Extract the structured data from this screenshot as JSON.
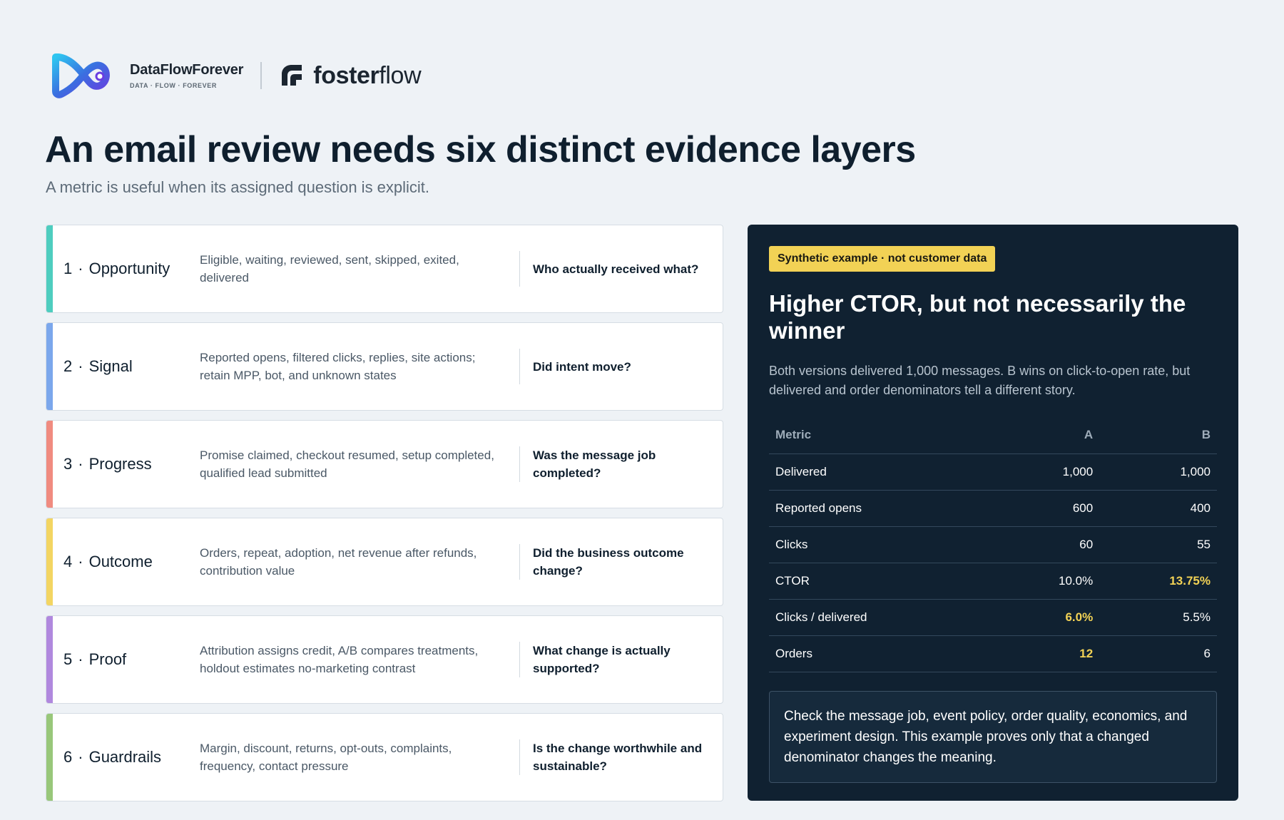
{
  "brand": {
    "dff_name": "DataFlowForever",
    "dff_tagline": "DATA · FLOW · FOREVER",
    "ff_bold": "foster",
    "ff_light": "flow"
  },
  "heading": {
    "title": "An email review needs six distinct evidence layers",
    "subtitle": "A metric is useful when its assigned question is explicit."
  },
  "layers": [
    {
      "num": "1",
      "name": "Opportunity",
      "desc": "Eligible, waiting, reviewed, sent, skipped, exited, delivered",
      "question": "Who actually received what?",
      "color": "#4ecdbf"
    },
    {
      "num": "2",
      "name": "Signal",
      "desc": "Reported opens, filtered clicks, replies, site actions; retain MPP, bot, and unknown states",
      "question": "Did intent move?",
      "color": "#7ba7ec"
    },
    {
      "num": "3",
      "name": "Progress",
      "desc": "Promise claimed, checkout resumed, setup completed, qualified lead submitted",
      "question": "Was the message job completed?",
      "color": "#f08b80"
    },
    {
      "num": "4",
      "name": "Outcome",
      "desc": "Orders, repeat, adoption, net revenue after refunds, contribution value",
      "question": "Did the business outcome change?",
      "color": "#f3d562"
    },
    {
      "num": "5",
      "name": "Proof",
      "desc": "Attribution assigns credit, A/B compares treatments, holdout estimates no-marketing contrast",
      "question": "What change is actually supported?",
      "color": "#b088de"
    },
    {
      "num": "6",
      "name": "Guardrails",
      "desc": "Margin, discount, returns, opt-outs, complaints, frequency, contact pressure",
      "question": "Is the change worthwhile and sustainable?",
      "color": "#98c77a"
    }
  ],
  "panel": {
    "badge": "Synthetic example · not customer data",
    "title": "Higher CTOR, but not necessarily the winner",
    "body": "Both versions delivered 1,000 messages. B wins on click-to-open rate, but delivered and order denominators tell a different story.",
    "table": {
      "headers": [
        "Metric",
        "A",
        "B"
      ],
      "rows": [
        {
          "metric": "Delivered",
          "a": "1,000",
          "b": "1,000",
          "highlight": ""
        },
        {
          "metric": "Reported opens",
          "a": "600",
          "b": "400",
          "highlight": ""
        },
        {
          "metric": "Clicks",
          "a": "60",
          "b": "55",
          "highlight": ""
        },
        {
          "metric": "CTOR",
          "a": "10.0%",
          "b": "13.75%",
          "highlight": "b"
        },
        {
          "metric": "Clicks / delivered",
          "a": "6.0%",
          "b": "5.5%",
          "highlight": "a"
        },
        {
          "metric": "Orders",
          "a": "12",
          "b": "6",
          "highlight": "a"
        }
      ]
    },
    "note": "Check the message job, event policy, order quality, economics, and experiment design. This example proves only that a changed denominator changes the meaning."
  },
  "colors": {
    "page_bg": "#eef2f6",
    "panel_bg": "#102131",
    "highlight": "#f2d255"
  },
  "icons": {
    "dff_logo": "infinity-loop-logo",
    "ff_logo": "fosterflow-leaf-logo"
  }
}
